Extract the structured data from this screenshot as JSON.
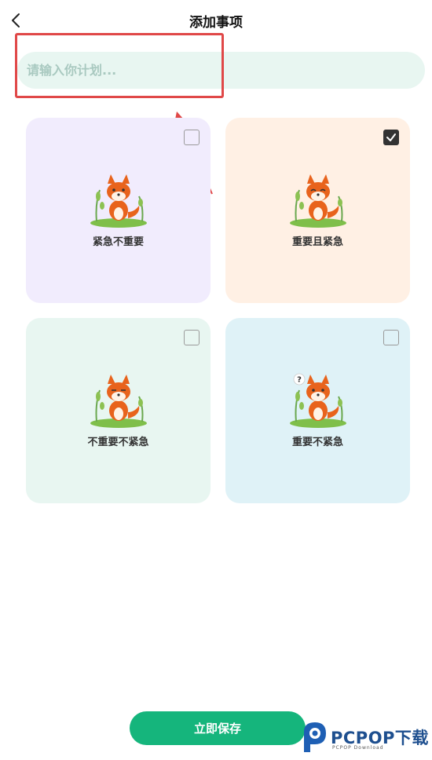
{
  "header": {
    "title": "添加事项",
    "back_icon": "chevron-left-icon"
  },
  "plan_input": {
    "placeholder": "请输入你计划...",
    "value": ""
  },
  "categories": [
    {
      "label": "紧急不重要",
      "checked": false,
      "background": "#f1ecfd",
      "fox": "smiling"
    },
    {
      "label": "重要且紧急",
      "checked": true,
      "background": "#fff0e4",
      "fox": "worried"
    },
    {
      "label": "不重要不紧急",
      "checked": false,
      "background": "#e8f6f1",
      "fox": "calm"
    },
    {
      "label": "重要不紧急",
      "checked": false,
      "background": "#dff2f7",
      "fox": "questioning"
    }
  ],
  "save_button": {
    "label": "立即保存",
    "color": "#15b57c"
  },
  "annotation": {
    "color": "#e04848"
  },
  "watermark": {
    "brand": "PCPOP下载",
    "sub": "PCPOP Download"
  }
}
